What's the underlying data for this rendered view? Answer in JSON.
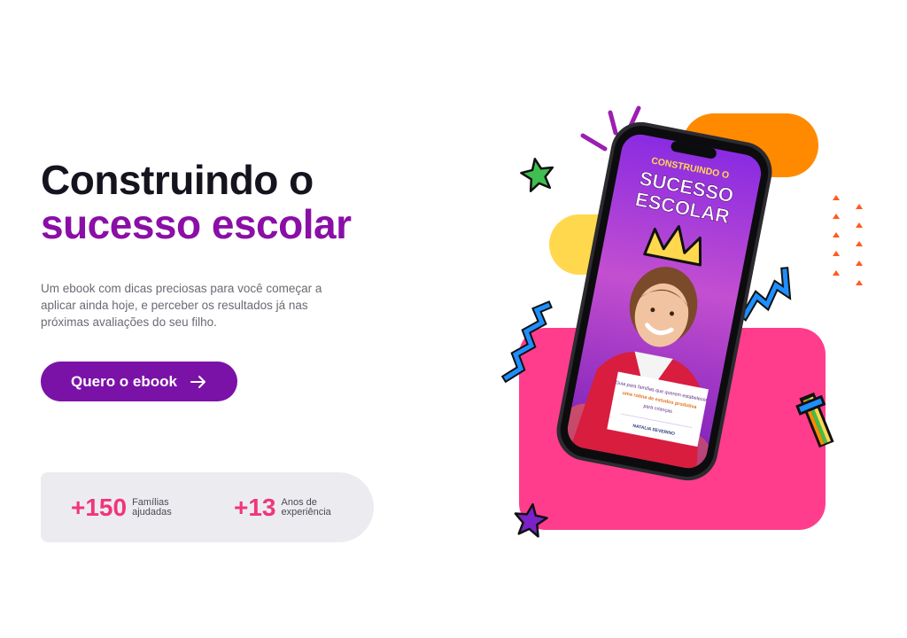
{
  "hero": {
    "title_line1": "Construindo o",
    "title_line2": "sucesso escolar",
    "description": "Um ebook com dicas preciosas para você começar a aplicar ainda hoje, e perceber os resultados já nas próximas avaliações do seu filho.",
    "cta_label": "Quero o ebook"
  },
  "stats": [
    {
      "value": "+150",
      "label": "Famílias ajudadas"
    },
    {
      "value": "+13",
      "label": "Anos de experiência"
    }
  ],
  "ebook_cover": {
    "kicker": "CONSTRUINDO O",
    "title_line1": "SUCESSO",
    "title_line2": "ESCOLAR",
    "card_text_1": "Guia para famílias que querem estabelecer",
    "card_highlight": "uma rotina de estudos produtiva",
    "card_text_2": "para crianças",
    "author": "NATALIA SEVERINO"
  },
  "colors": {
    "brand_purple": "#7b12a8",
    "title_purple": "#8a0fa6",
    "accent_pink": "#f0357c",
    "orange": "#ff8a00",
    "yellow": "#ffd84d",
    "block_pink": "#ff3d8c"
  },
  "icons": [
    "arrow-right-icon",
    "green-star-icon",
    "purple-star-icon",
    "zigzag-icon",
    "triangle-icon",
    "cross-icon",
    "crown-icon"
  ]
}
